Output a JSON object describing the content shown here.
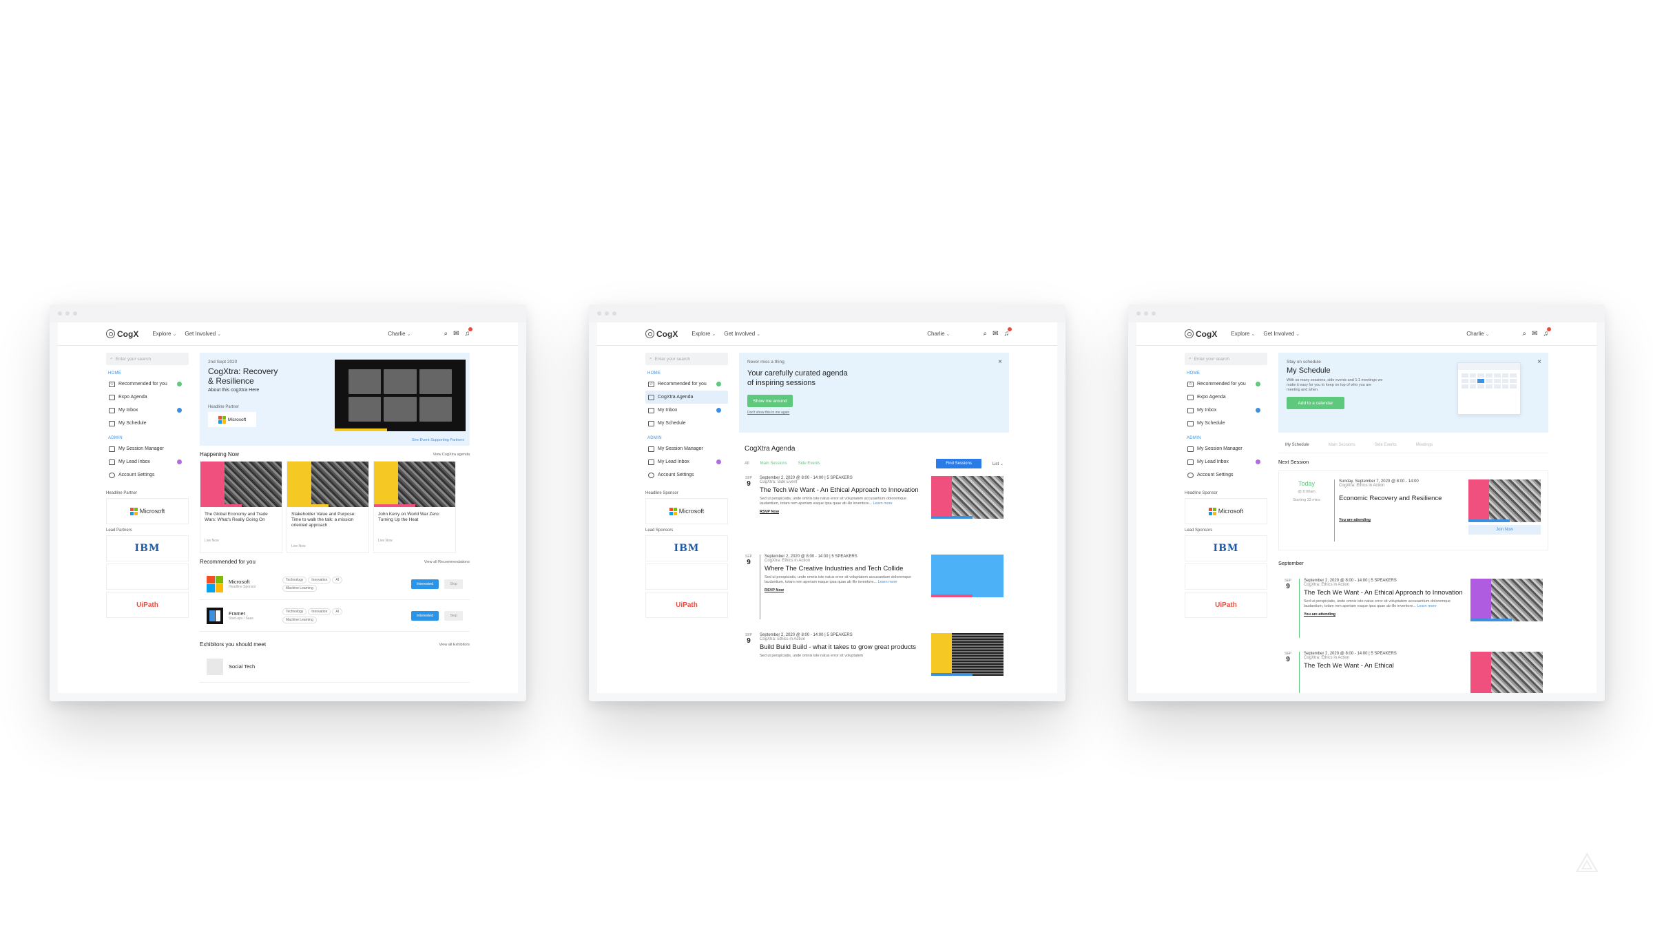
{
  "topbar": {
    "logo": "CogX",
    "explore": "Explore",
    "get_involved": "Get Involved",
    "user": "Charlie"
  },
  "sidebar": {
    "search_placeholder": "Enter your search",
    "home_section": "HOME",
    "admin_section": "ADMIN",
    "items": {
      "recommended": "Recommended for you",
      "expo": "Expo Agenda",
      "cogxtra": "CogXtra Agenda",
      "inbox": "My Inbox",
      "schedule": "My Schedule",
      "session_manager": "My Session Manager",
      "lead_inbox": "My Lead Inbox",
      "account": "Account Settings"
    },
    "headline_partner_label": "Headline Partner",
    "headline_sponsor_label": "Headline Sponsor",
    "lead_partners_label": "Lead Partners",
    "lead_sponsors_label": "Lead Sponsors",
    "microsoft": "Microsoft",
    "ibm": "IBM",
    "uipath": "UiPath"
  },
  "screen1": {
    "hero": {
      "date": "2nd Sept 2020",
      "title": "CogXtra: Recovery & Resilience",
      "subtitle": "About this cogXtra Here",
      "partner_label": "Headline Partner",
      "partner": "Microsoft",
      "video_link": "See Event Supporting Partners"
    },
    "happening_now": "Happening Now",
    "view_agenda": "View CogXtra agenda",
    "cards": [
      {
        "title": "The Global Economy and Trade Wars: What's Really Going On",
        "meta": "Live Now",
        "color": "#f0507e"
      },
      {
        "title": "Stakeholder Value and Purpose: Time to walk the talk: a mission oriented approach",
        "meta": "Live Now",
        "color": "#f6c823"
      },
      {
        "title": "John Kerry on World War Zero: Turning Up the Heat",
        "meta": "Live Now",
        "color": "#f6c823"
      }
    ],
    "recommended": "Recommended for you",
    "view_recommendations": "View all Recommendations",
    "rec_items": [
      {
        "name": "Microsoft",
        "sub": "Headline Sponsor",
        "tags": [
          "Technology",
          "Innovation",
          "AI",
          "Machine Learning"
        ]
      },
      {
        "name": "Framer",
        "sub": "Start-ups / Saas",
        "tags": [
          "Technology",
          "Innovation",
          "AI",
          "Machine Learning"
        ]
      }
    ],
    "interested": "Interested",
    "skip": "Skip",
    "exhibitors": "Exhibitors you should meet",
    "view_exhibitors": "View all Exhibitors",
    "exhibitor_name": "Social Tech"
  },
  "screen2": {
    "banner": {
      "eyebrow": "Never miss a thing",
      "title": "Your carefully curated agenda of inspiring sessions",
      "button": "Show me around",
      "link": "Don't show this to me again"
    },
    "agenda_title": "CogXtra Agenda",
    "filters": {
      "all": "All",
      "main": "Main Sessions",
      "side": "Side Events",
      "find": "Find Sessions",
      "list": "List"
    },
    "sessions": [
      {
        "month": "SEP",
        "day": "9",
        "time": "September 2, 2020 @ 8:00 - 14:00 | 5 SPEAKERS",
        "track": "CogXtra: Side Event",
        "title": "The Tech We Want - An Ethical Approach to Innovation",
        "desc": "Sed ut perspiciatis, unde omnis iste natus error sit voluptatem accusantium doloremque laudantium, totam rem aperiam eaque ipsa quae ab illo inventore...",
        "more": "Learn more",
        "cta": "RSVP Now",
        "color": "#f0507e"
      },
      {
        "month": "SEP",
        "day": "9",
        "time": "September 2, 2020 @ 8:00 - 14:00 | 5 SPEAKERS",
        "track": "CogXtra: Ethics in Action",
        "title": "Where The Creative Industries and Tech Collide",
        "desc": "Sed ut perspiciatis, unde omnis iste natus error sit voluptatem accusantium doloremque laudantium, totam rem aperiam eaque ipsa quae ab illo inventore...",
        "more": "Learn more",
        "cta": "RSVP Now",
        "color": "#4db1f7"
      },
      {
        "month": "SEP",
        "day": "9",
        "time": "September 2, 2020 @ 8:00 - 14:00 | 5 SPEAKERS",
        "track": "CogXtra: Ethics in Action",
        "title": "Build Build Build - what it takes to grow great products",
        "desc": "Sed ut perspiciatis, unde omnis iste natus error sit voluptatem",
        "more": "",
        "cta": "",
        "color": "#f6c823"
      }
    ]
  },
  "screen3": {
    "banner": {
      "eyebrow": "Stay on schedule",
      "title": "My Schedule",
      "desc": "With so many sessions, side events and 1:1 meetings we make it easy for you to keep on top of who you are meeting and when.",
      "button": "Add to a calendar"
    },
    "tabs": [
      "My Schedule",
      "Main Sessions",
      "Side Events",
      "Meetings"
    ],
    "next_session": "Next Session",
    "next": {
      "today": "Today",
      "time": "@ 8:00am",
      "starting": "Starting 33 mins",
      "meta": "Sunday, September 7, 2020 @ 8:00 - 14:00",
      "track": "CogXtra: Ethics in Action",
      "title": "Economic Recovery and Resilience",
      "attending": "You are attending",
      "join": "Join Now"
    },
    "month": "September",
    "sessions": [
      {
        "month": "SEP",
        "day": "9",
        "time": "September 2, 2020 @ 8:00 - 14:00 | 5 SPEAKERS",
        "track": "CogXtra: Ethics in Action",
        "title": "The Tech We Want - An Ethical Approach to Innovation",
        "desc": "Sed ut perspiciatis, unde omnis iste natus error sit voluptatem accusantium doloremque laudantium, totam rem aperiam eaque ipsa quae ab illo inventore...",
        "more": "Learn more",
        "cta": "You are attending",
        "color": "#b05ce0"
      },
      {
        "month": "SEP",
        "day": "9",
        "time": "September 2, 2020 @ 8:00 - 14:00 | 5 SPEAKERS",
        "track": "CogXtra: Ethics in Action",
        "title": "The Tech We Want - An Ethical",
        "color": "#f0507e"
      }
    ]
  }
}
